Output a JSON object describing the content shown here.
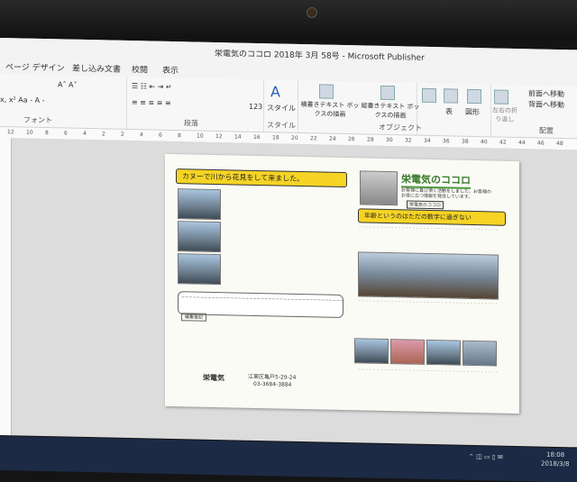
{
  "window": {
    "title": "栄電気のココロ 2018年 3月 58号 - Microsoft Publisher"
  },
  "tabs": [
    "ページ デザイン",
    "差し込み文書",
    "校閲",
    "表示"
  ],
  "ribbon": {
    "font_group_label": "フォント",
    "paragraph_group_label": "段落",
    "style_button": "スタイル",
    "style_group_label": "スタイル",
    "horizontal_textbox": "横書きテキスト ボックスの描画",
    "vertical_textbox": "縦書きテキスト ボックスの描画",
    "object_group_label": "オブジェクト",
    "table_button": "表",
    "shape_button": "図形",
    "rotate_button": "左右の折り返し",
    "bring_forward": "前面へ移動",
    "send_backward": "背面へ移動",
    "arrange_group_label": "配置",
    "line_spacing": "123"
  },
  "ruler_ticks": [
    "12",
    "10",
    "8",
    "6",
    "4",
    "2",
    "2",
    "4",
    "6",
    "8",
    "10",
    "12",
    "14",
    "16",
    "18",
    "20",
    "22",
    "24",
    "26",
    "28",
    "30",
    "32",
    "34",
    "36",
    "38",
    "40",
    "42",
    "44",
    "46",
    "48"
  ],
  "page": {
    "left_banner": "カヌーで川から花見をして来ました。",
    "header_title": "栄電気のココロ",
    "header_desc": "お客様に喜び頂く活動をしました。お客様のお役に立つ情報を発信しています。",
    "header_tag": "栄電気のココロ",
    "right_banner": "年齢というのはただの数字に過ぎない",
    "left_button": "編集後記",
    "company_name": "栄電気",
    "address": "江東区亀戸5-29-24",
    "phone": "03-3684-3884"
  },
  "status": {
    "time": "18:08",
    "date": "2018/3/8"
  }
}
